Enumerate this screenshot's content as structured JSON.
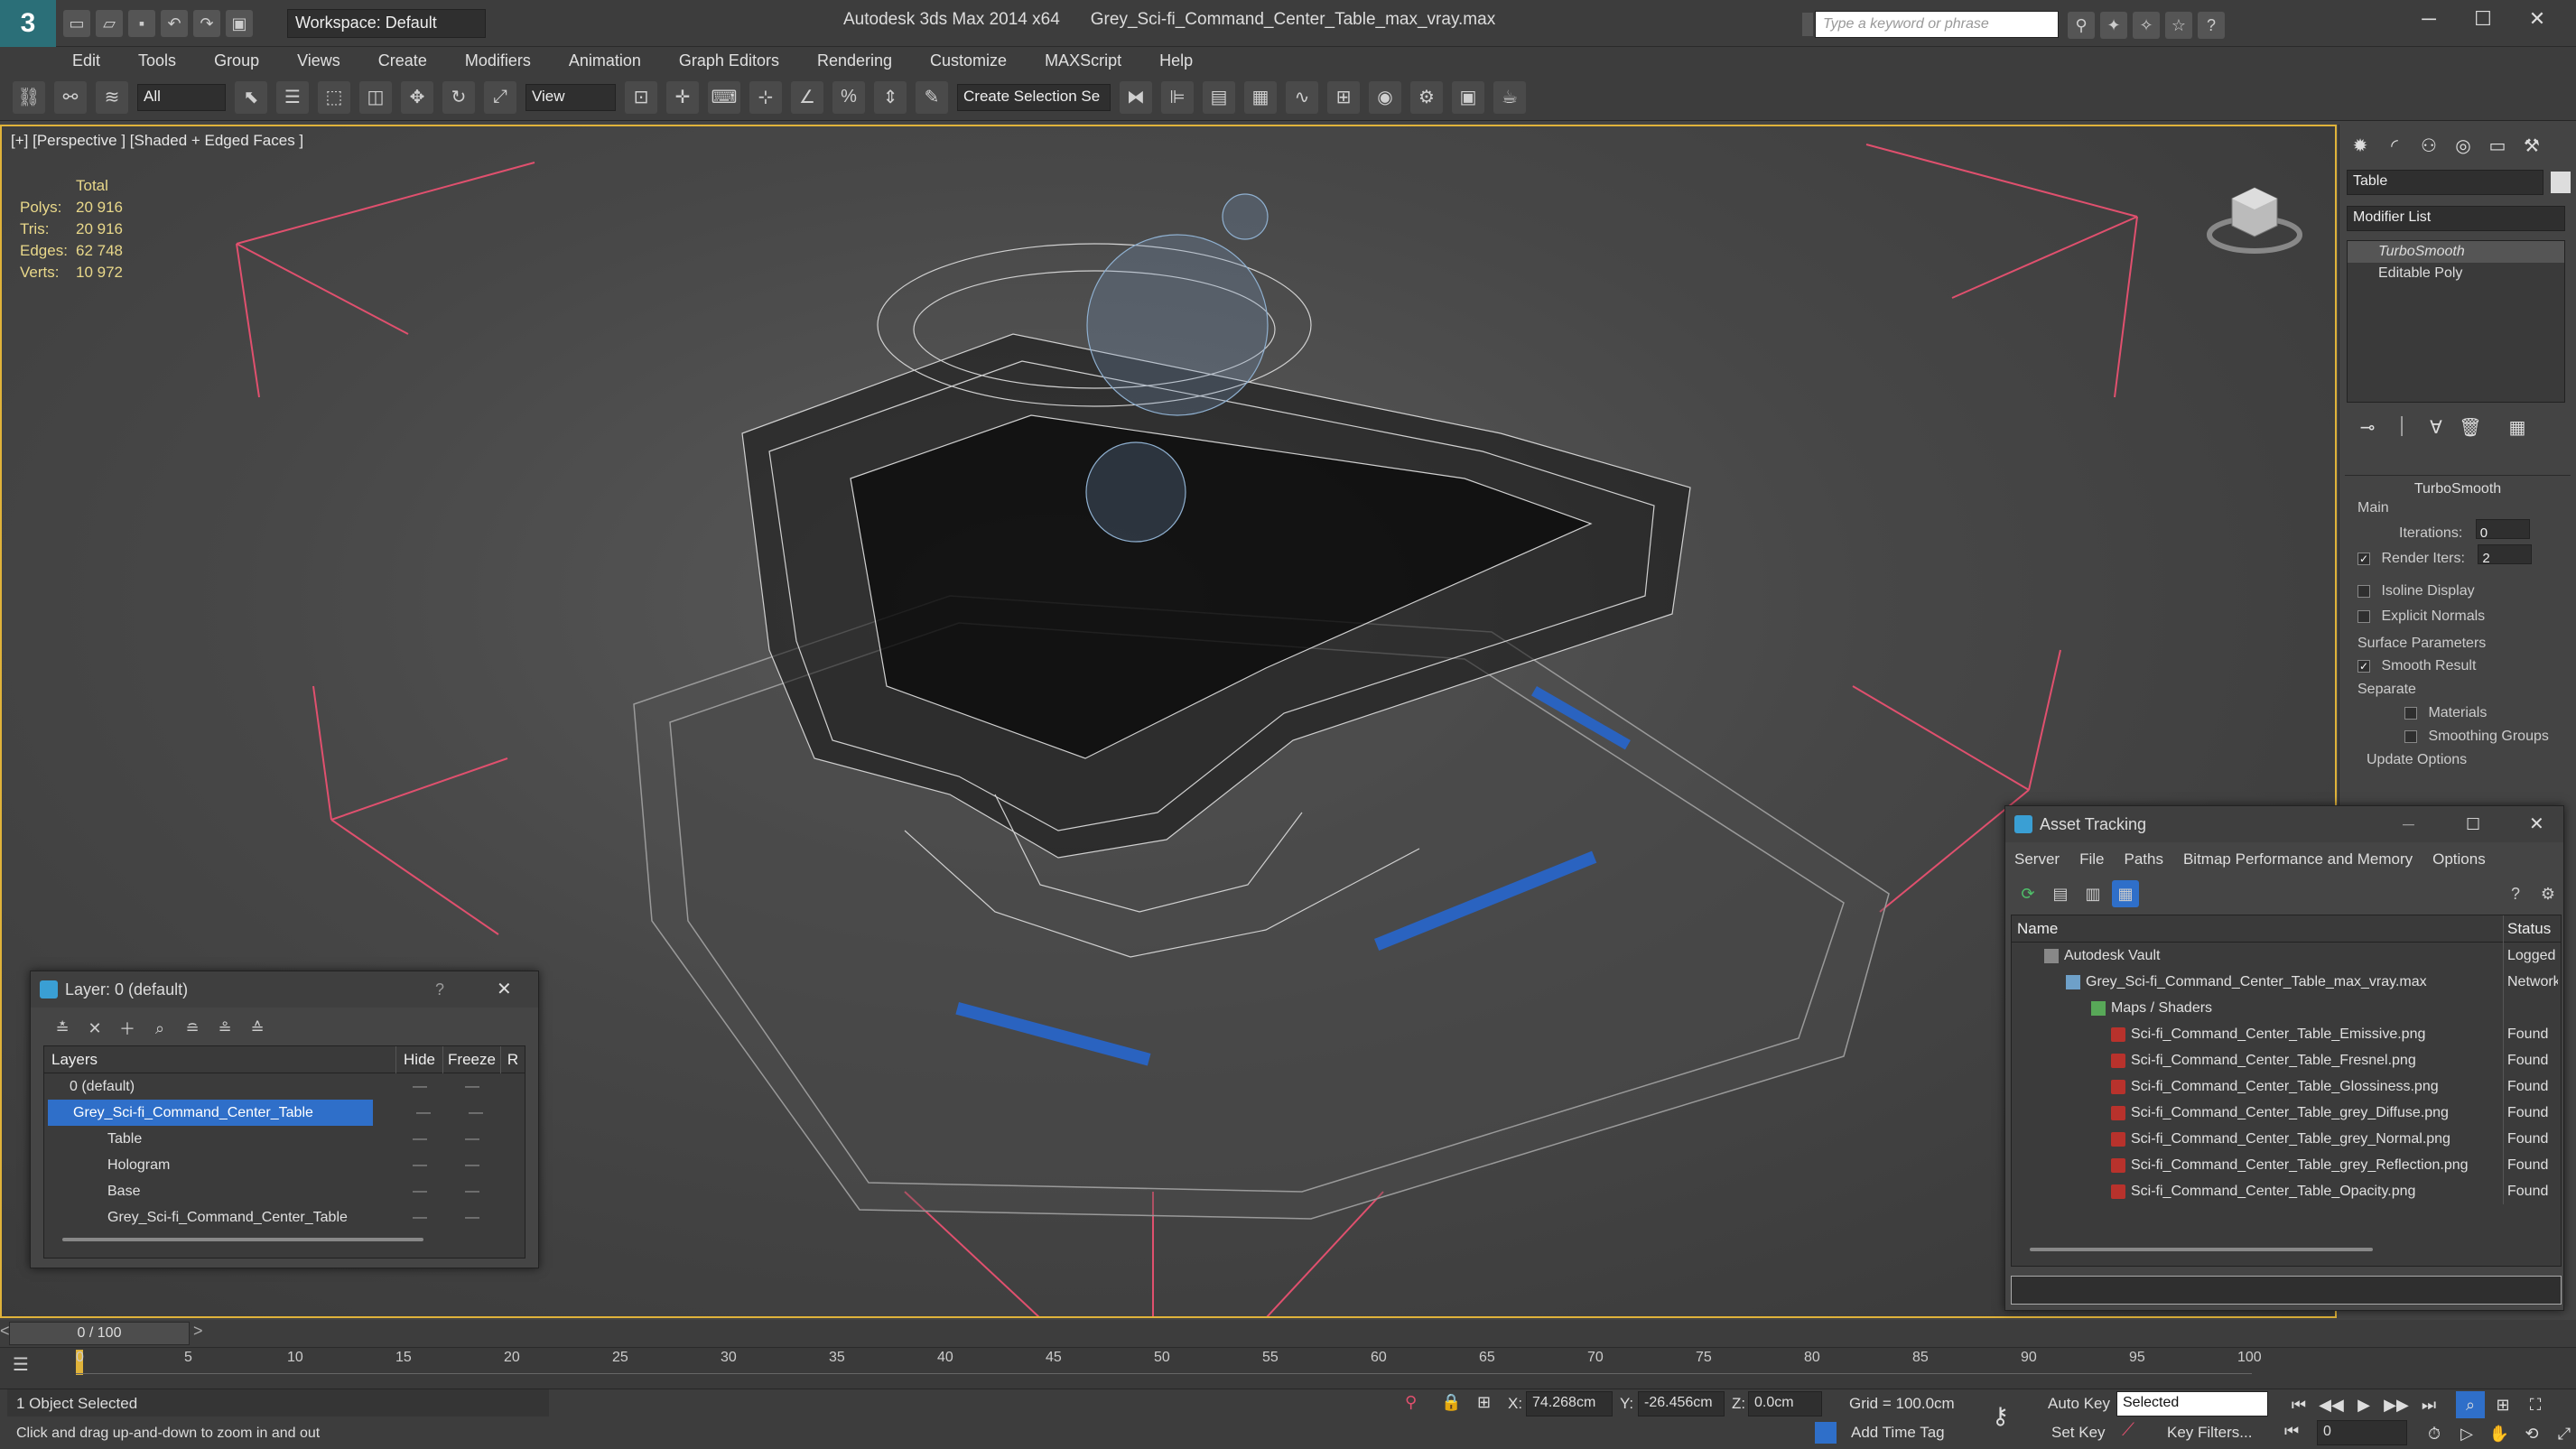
{
  "title_bar": {
    "workspace": "Workspace: Default",
    "app_name": "Autodesk 3ds Max  2014 x64",
    "file_name": "Grey_Sci-fi_Command_Center_Table_max_vray.max",
    "search_placeholder": "Type a keyword or phrase"
  },
  "menu": [
    "Edit",
    "Tools",
    "Group",
    "Views",
    "Create",
    "Modifiers",
    "Animation",
    "Graph Editors",
    "Rendering",
    "Customize",
    "MAXScript",
    "Help"
  ],
  "toolbar": {
    "selection_filter": "All",
    "ref_coord": "View",
    "named_selection": "Create Selection Se"
  },
  "viewport": {
    "label": "[+] [Perspective ] [Shaded + Edged Faces ]",
    "stats": {
      "header": "Total",
      "rows": [
        {
          "label": "Polys:",
          "value": "20 916"
        },
        {
          "label": "Tris:",
          "value": "20 916"
        },
        {
          "label": "Edges:",
          "value": "62 748"
        },
        {
          "label": "Verts:",
          "value": "10 972"
        }
      ]
    }
  },
  "command_panel": {
    "object_name": "Table",
    "modifier_list": "Modifier List",
    "stack": [
      "TurboSmooth",
      "Editable Poly"
    ],
    "rollout_title": "TurboSmooth",
    "main_label": "Main",
    "iterations_label": "Iterations:",
    "iterations_value": "0",
    "render_iters_label": "Render Iters:",
    "render_iters_value": "2",
    "isoline_label": "Isoline Display",
    "explicit_normals_label": "Explicit Normals",
    "surface_params_label": "Surface Parameters",
    "smooth_result_label": "Smooth Result",
    "separate_label": "Separate",
    "materials_label": "Materials",
    "smoothing_groups_label": "Smoothing Groups",
    "update_options_label": "Update Options"
  },
  "layer_dialog": {
    "title": "Layer: 0 (default)",
    "help": "?",
    "columns": [
      "Layers",
      "Hide",
      "Freeze",
      "R"
    ],
    "rows": [
      {
        "name": "0 (default)",
        "indent": 0
      },
      {
        "name": "Grey_Sci-fi_Command_Center_Table",
        "indent": 0
      },
      {
        "name": "Table",
        "indent": 1
      },
      {
        "name": "Hologram",
        "indent": 1
      },
      {
        "name": "Base",
        "indent": 1
      },
      {
        "name": "Grey_Sci-fi_Command_Center_Table",
        "indent": 1
      }
    ]
  },
  "asset_dialog": {
    "title": "Asset Tracking",
    "menu": [
      "Server",
      "File",
      "Paths",
      "Bitmap Performance and Memory",
      "Options"
    ],
    "columns": [
      "Name",
      "Status"
    ],
    "rows": [
      {
        "name": "Autodesk Vault",
        "status": "Logged",
        "indent": 1
      },
      {
        "name": "Grey_Sci-fi_Command_Center_Table_max_vray.max",
        "status": "Network",
        "indent": 2
      },
      {
        "name": "Maps / Shaders",
        "status": "",
        "indent": 3
      },
      {
        "name": "Sci-fi_Command_Center_Table_Emissive.png",
        "status": "Found",
        "indent": 4
      },
      {
        "name": "Sci-fi_Command_Center_Table_Fresnel.png",
        "status": "Found",
        "indent": 4
      },
      {
        "name": "Sci-fi_Command_Center_Table_Glossiness.png",
        "status": "Found",
        "indent": 4
      },
      {
        "name": "Sci-fi_Command_Center_Table_grey_Diffuse.png",
        "status": "Found",
        "indent": 4
      },
      {
        "name": "Sci-fi_Command_Center_Table_grey_Normal.png",
        "status": "Found",
        "indent": 4
      },
      {
        "name": "Sci-fi_Command_Center_Table_grey_Reflection.png",
        "status": "Found",
        "indent": 4
      },
      {
        "name": "Sci-fi_Command_Center_Table_Opacity.png",
        "status": "Found",
        "indent": 4
      }
    ]
  },
  "timeline": {
    "frame": "0 / 100",
    "ticks": [
      "0",
      "5",
      "10",
      "15",
      "20",
      "25",
      "30",
      "35",
      "40",
      "45",
      "50",
      "55",
      "60",
      "65",
      "70",
      "75",
      "80",
      "85",
      "90",
      "95",
      "100"
    ]
  },
  "status_bar": {
    "selection": "1 Object Selected",
    "prompt": "Click and drag up-and-down to zoom in and out",
    "x_label": "X:",
    "x_value": "74.268cm",
    "y_label": "Y:",
    "y_value": "-26.456cm",
    "z_label": "Z:",
    "z_value": "0.0cm",
    "grid": "Grid = 100.0cm",
    "add_time_tag": "Add Time Tag",
    "auto_key": "Auto Key",
    "set_key": "Set Key",
    "key_mode": "Selected",
    "key_filters": "Key Filters...",
    "frame_value": "0"
  },
  "colors": {
    "accent": "#e0b33a",
    "selection": "#2f6fc9",
    "frame_lines": "#e0506e",
    "wire": "#e8e8e8"
  }
}
